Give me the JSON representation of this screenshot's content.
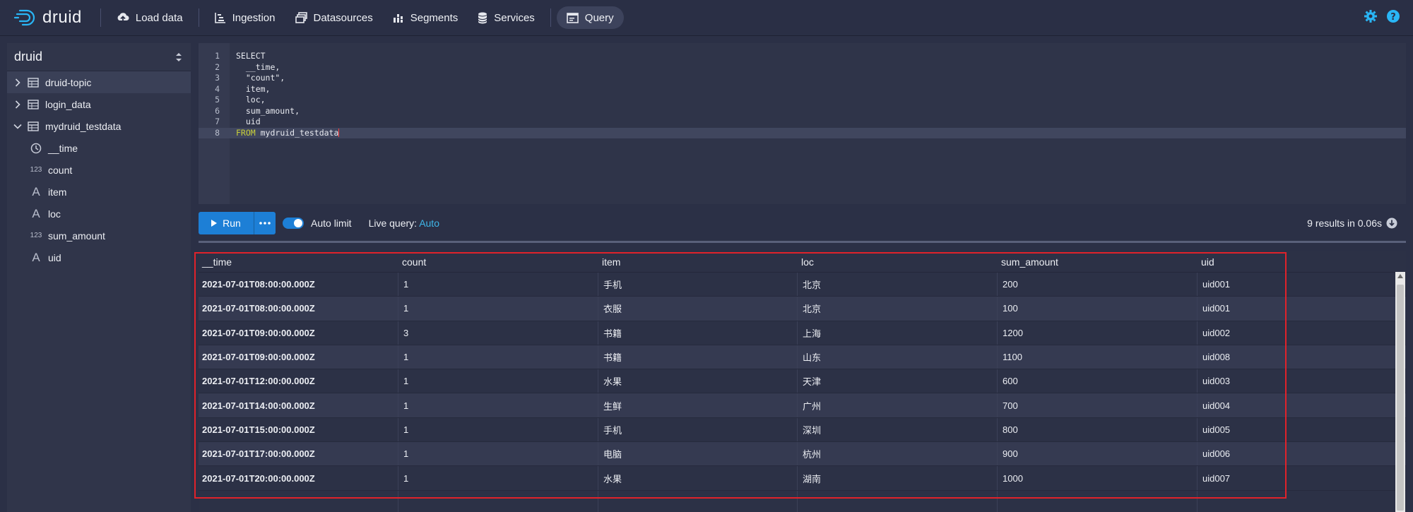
{
  "app": {
    "name": "druid"
  },
  "nav": {
    "items": [
      {
        "label": "Load data",
        "icon": "cloud-upload-icon"
      },
      {
        "label": "Ingestion",
        "icon": "gantt-chart-icon"
      },
      {
        "label": "Datasources",
        "icon": "multi-select-icon"
      },
      {
        "label": "Segments",
        "icon": "stacked-chart-icon"
      },
      {
        "label": "Services",
        "icon": "database-icon"
      },
      {
        "label": "Query",
        "icon": "application-icon"
      }
    ],
    "active": "Query"
  },
  "sidebar": {
    "title": "druid",
    "tables": [
      {
        "name": "druid-topic",
        "expanded": false
      },
      {
        "name": "login_data",
        "expanded": false
      },
      {
        "name": "mydruid_testdata",
        "expanded": true
      }
    ],
    "columns": [
      {
        "name": "__time",
        "type": "time-icon"
      },
      {
        "name": "count",
        "type": "numeric",
        "badge": "123"
      },
      {
        "name": "item",
        "type": "string",
        "badge": "A"
      },
      {
        "name": "loc",
        "type": "string",
        "badge": "A"
      },
      {
        "name": "sum_amount",
        "type": "numeric",
        "badge": "123"
      },
      {
        "name": "uid",
        "type": "string",
        "badge": "A"
      }
    ]
  },
  "editor": {
    "line_numbers": [
      "1",
      "2",
      "3",
      "4",
      "5",
      "6",
      "7",
      "8"
    ],
    "lines": [
      "SELECT",
      "  __time,",
      "  \"count\",",
      "  item,",
      "  loc,",
      "  sum_amount,",
      "  uid",
      "FROM mydruid_testdata"
    ]
  },
  "toolbar": {
    "run_label": "Run",
    "auto_limit_label": "Auto limit",
    "live_query_label": "Live query:",
    "live_query_value": "Auto",
    "results_summary": "9 results in 0.06s"
  },
  "table": {
    "columns": [
      "__time",
      "count",
      "item",
      "loc",
      "sum_amount",
      "uid"
    ],
    "rows": [
      [
        "2021-07-01T08:00:00.000Z",
        "1",
        "手机",
        "北京",
        "200",
        "uid001"
      ],
      [
        "2021-07-01T08:00:00.000Z",
        "1",
        "衣服",
        "北京",
        "100",
        "uid001"
      ],
      [
        "2021-07-01T09:00:00.000Z",
        "3",
        "书籍",
        "上海",
        "1200",
        "uid002"
      ],
      [
        "2021-07-01T09:00:00.000Z",
        "1",
        "书籍",
        "山东",
        "1100",
        "uid008"
      ],
      [
        "2021-07-01T12:00:00.000Z",
        "1",
        "水果",
        "天津",
        "600",
        "uid003"
      ],
      [
        "2021-07-01T14:00:00.000Z",
        "1",
        "生鲜",
        "广州",
        "700",
        "uid004"
      ],
      [
        "2021-07-01T15:00:00.000Z",
        "1",
        "手机",
        "深圳",
        "800",
        "uid005"
      ],
      [
        "2021-07-01T17:00:00.000Z",
        "1",
        "电脑",
        "杭州",
        "900",
        "uid006"
      ],
      [
        "2021-07-01T20:00:00.000Z",
        "1",
        "水果",
        "湖南",
        "1000",
        "uid007"
      ]
    ]
  },
  "colors": {
    "accent": "#1d7fd6",
    "keyword": "#c9d03a",
    "string": "#5cc6e8",
    "link": "#3fb6e8",
    "highlight_box": "#e0222a"
  }
}
